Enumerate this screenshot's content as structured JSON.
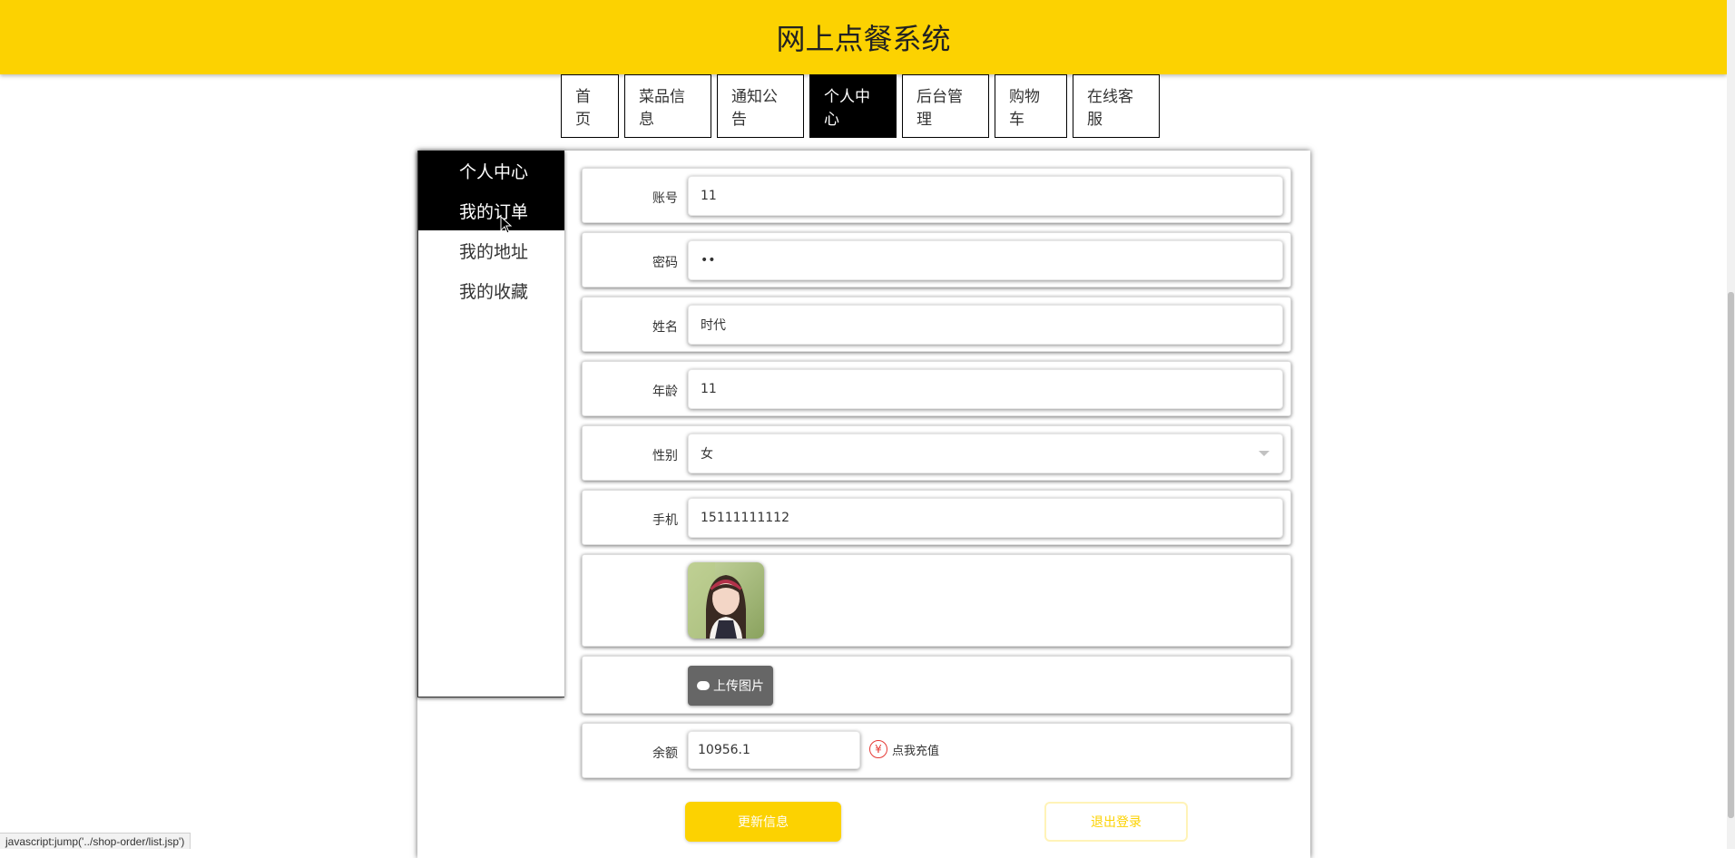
{
  "header": {
    "title": "网上点餐系统"
  },
  "nav": {
    "items": [
      {
        "label": "首页"
      },
      {
        "label": "菜品信息"
      },
      {
        "label": "通知公告"
      },
      {
        "label": "个人中心"
      },
      {
        "label": "后台管理"
      },
      {
        "label": "购物车"
      },
      {
        "label": "在线客服"
      }
    ],
    "active_index": 3
  },
  "sidebar": {
    "items": [
      {
        "label": "个人中心"
      },
      {
        "label": "我的订单"
      },
      {
        "label": "我的地址"
      },
      {
        "label": "我的收藏"
      }
    ]
  },
  "form": {
    "account": {
      "label": "账号",
      "value": "11"
    },
    "password": {
      "label": "密码",
      "value": "••"
    },
    "name": {
      "label": "姓名",
      "value": "时代"
    },
    "age": {
      "label": "年龄",
      "value": "11"
    },
    "gender": {
      "label": "性别",
      "value": "女"
    },
    "phone": {
      "label": "手机",
      "value": "15111111112"
    },
    "upload_label": "上传图片",
    "balance": {
      "label": "余额",
      "value": "10956.1"
    },
    "recharge_label": "点我充值",
    "recharge_icon": "¥"
  },
  "actions": {
    "update_label": "更新信息",
    "logout_label": "退出登录"
  },
  "status_bar": {
    "text": "javascript:jump('../shop-order/list.jsp')"
  },
  "colors": {
    "brand": "#fcd201",
    "nav_active": "#000000"
  }
}
